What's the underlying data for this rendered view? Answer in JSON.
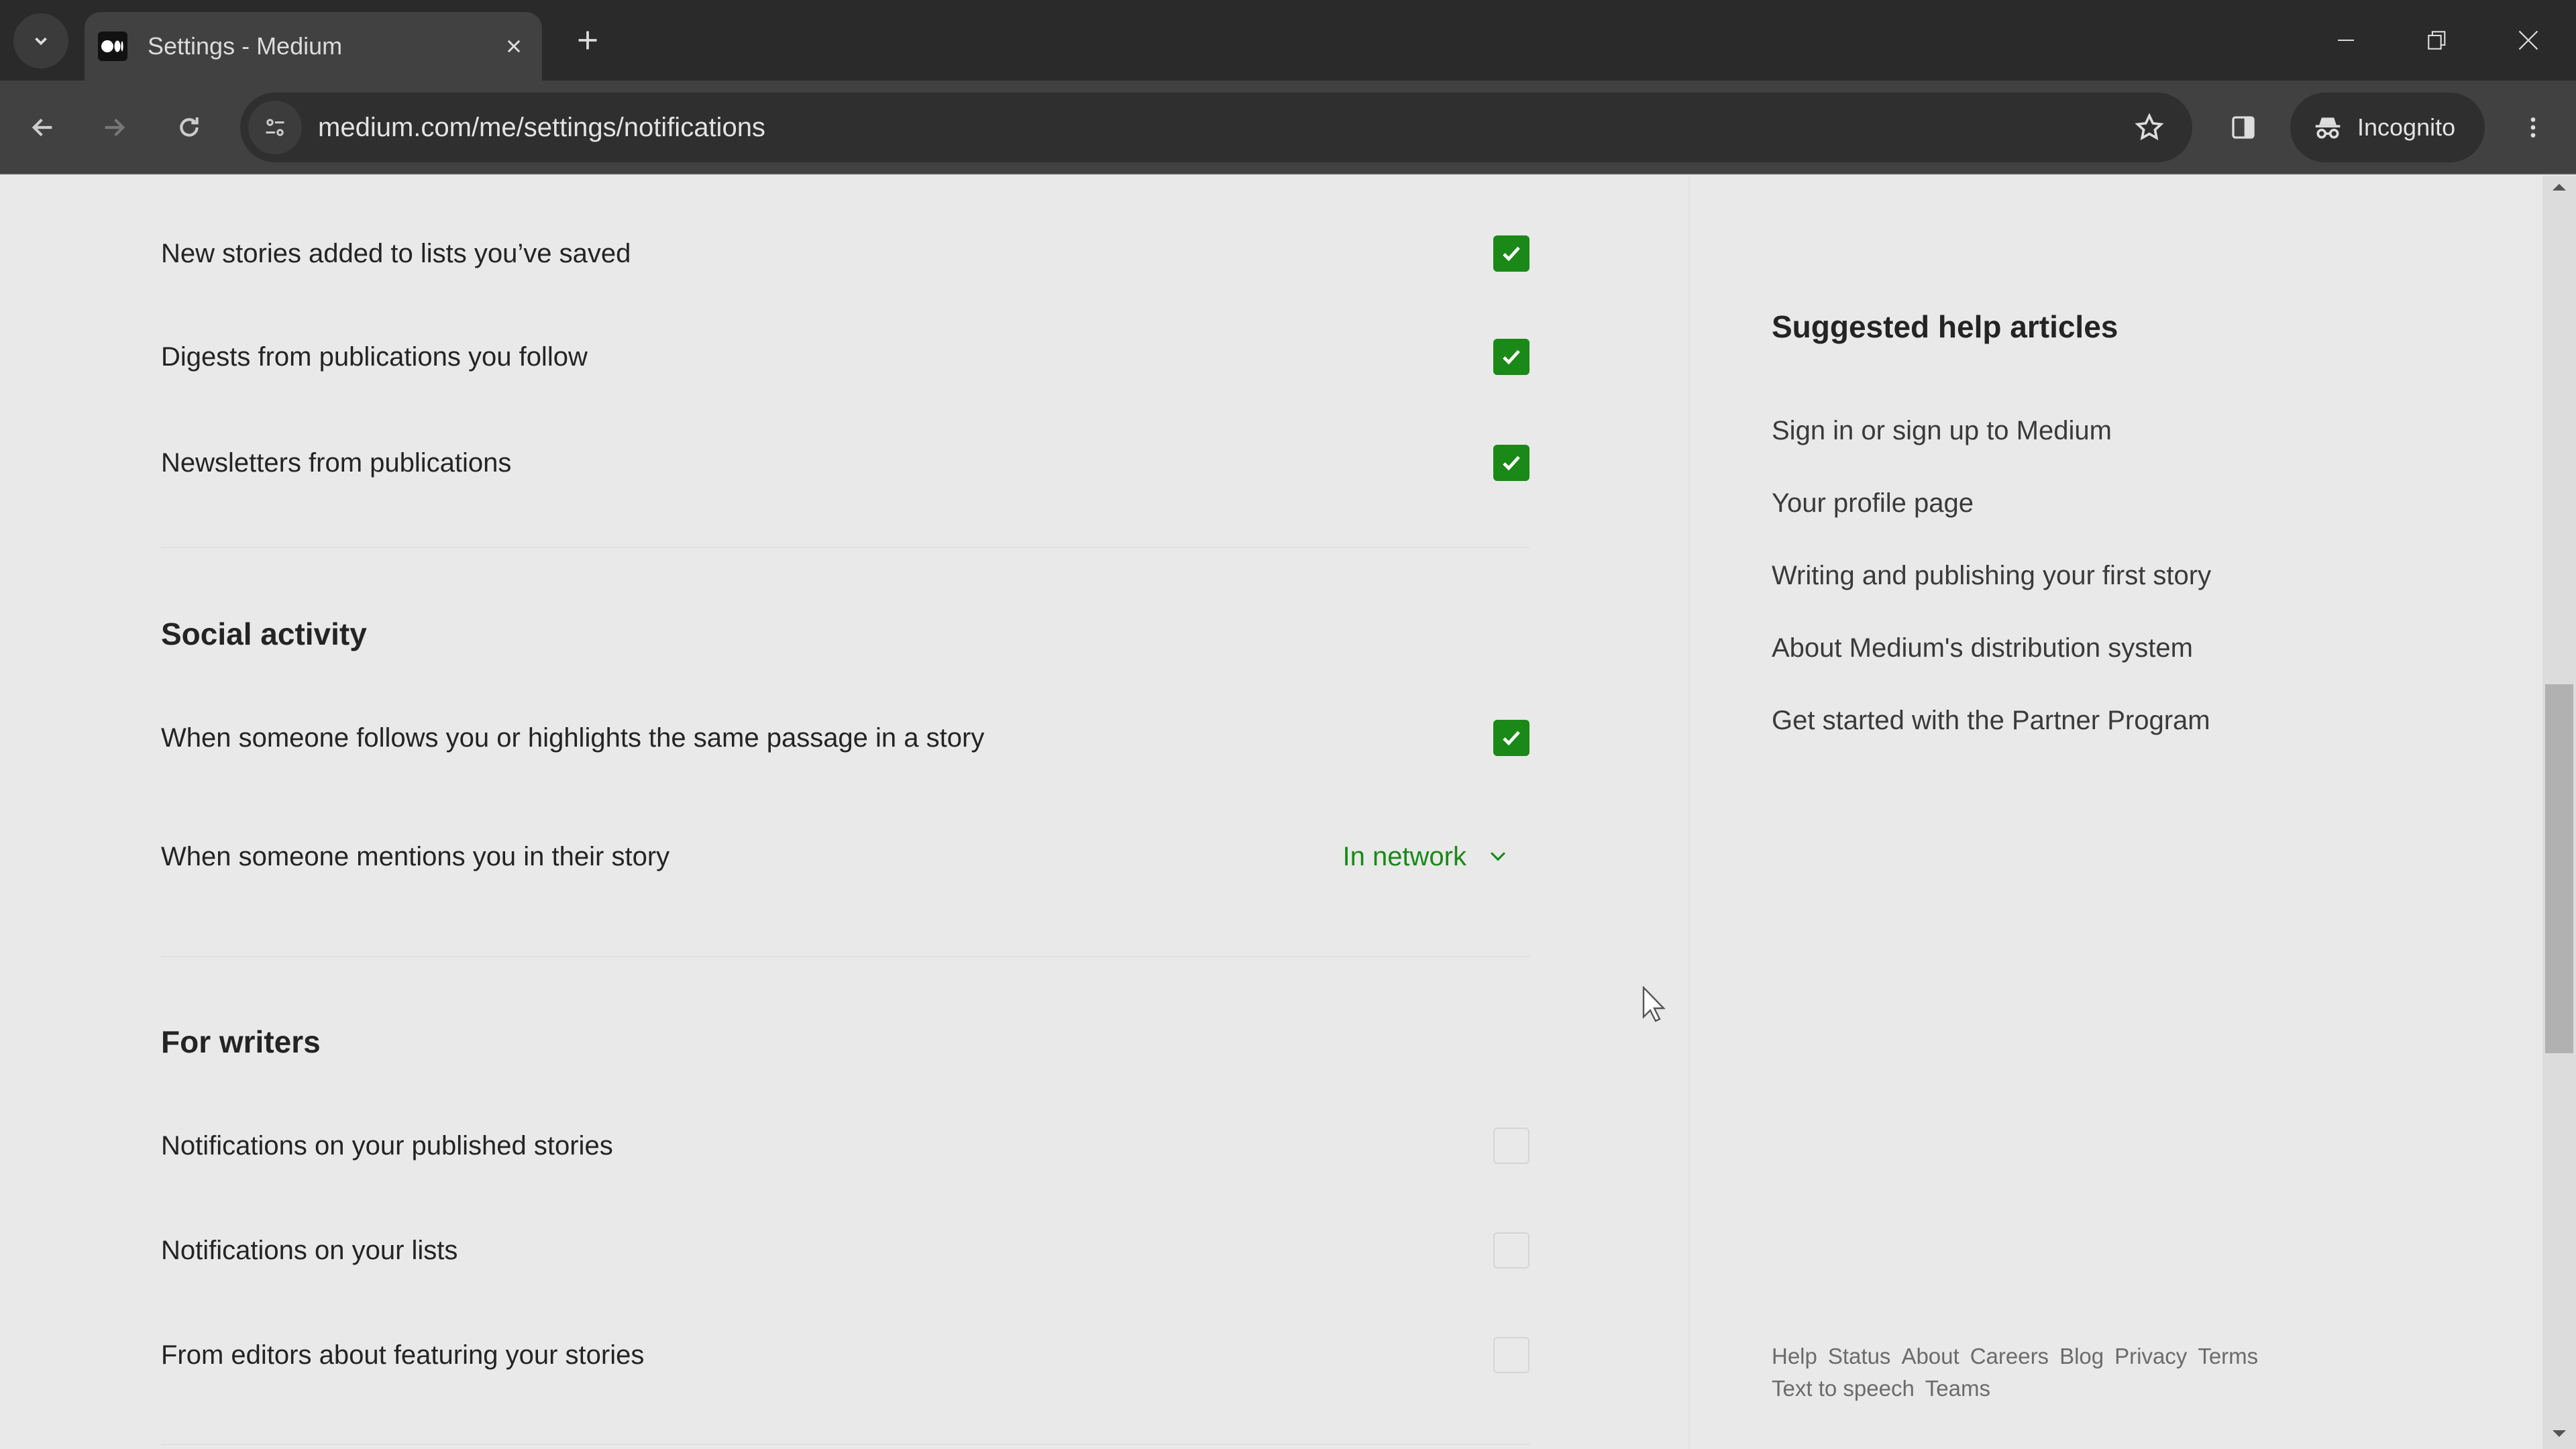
{
  "browser": {
    "tab_title": "Settings - Medium",
    "url": "medium.com/me/settings/notifications",
    "incognito_label": "Incognito"
  },
  "colors": {
    "accent_green": "#1a8917",
    "background": "#e9e9e9",
    "text": "#242424"
  },
  "sections": {
    "top": {
      "rows": [
        {
          "label": "New stories added to lists you’ve saved",
          "checked": true
        },
        {
          "label": "Digests from publications you follow",
          "checked": true
        },
        {
          "label": "Newsletters from publications",
          "checked": true
        }
      ]
    },
    "social": {
      "title": "Social activity",
      "rows": [
        {
          "label": "When someone follows you or highlights the same passage in a story",
          "checked": true
        },
        {
          "label": "When someone mentions you in their story",
          "dropdown_value": "In network"
        }
      ]
    },
    "writers": {
      "title": "For writers",
      "rows": [
        {
          "label": "Notifications on your published stories",
          "checked": false
        },
        {
          "label": "Notifications on your lists",
          "checked": false
        },
        {
          "label": "From editors about featuring your stories",
          "checked": false
        }
      ]
    }
  },
  "sidebar": {
    "title": "Suggested help articles",
    "links": [
      "Sign in or sign up to Medium",
      "Your profile page",
      "Writing and publishing your first story",
      "About Medium's distribution system",
      "Get started with the Partner Program"
    ],
    "footer": [
      "Help",
      "Status",
      "About",
      "Careers",
      "Blog",
      "Privacy",
      "Terms",
      "Text to speech",
      "Teams"
    ]
  },
  "icons": {
    "tab_search": "chevron-down-icon",
    "favicon": "medium-logo-icon",
    "close_tab": "close-icon",
    "new_tab": "plus-icon",
    "back": "arrow-left-icon",
    "forward": "arrow-right-icon",
    "reload": "reload-icon",
    "site_info": "tune-icon",
    "bookmark": "star-icon",
    "side_panel": "side-panel-icon",
    "incognito": "incognito-icon",
    "menu": "more-vertical-icon"
  }
}
